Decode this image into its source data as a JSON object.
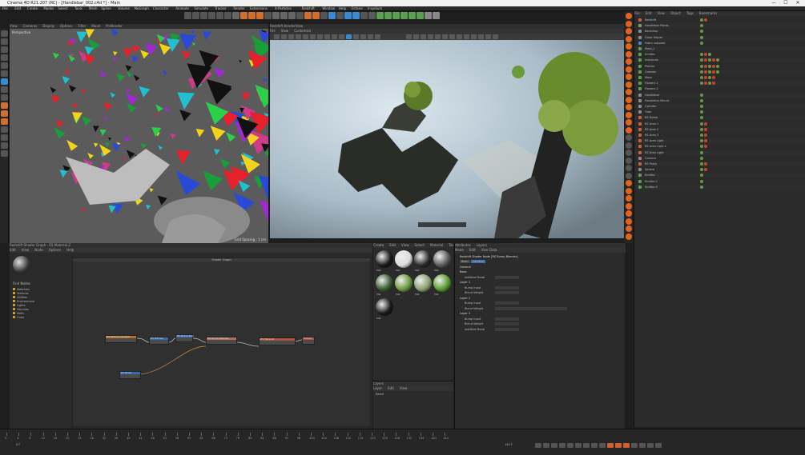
{
  "window": {
    "title": "Cinema 4D R21.207 (RC) - [Handlebar_002.c4d *] - Main",
    "minimize": "—",
    "maximize": "☐",
    "close": "✕"
  },
  "menu": [
    "File",
    "Edit",
    "Create",
    "Modes",
    "Select",
    "Tools",
    "Mesh",
    "Spline",
    "Volume",
    "MoGraph",
    "Character",
    "Animate",
    "Simulate",
    "Tracker",
    "Render",
    "Extensions",
    "X-Particles",
    "Redshift",
    "Window",
    "Help",
    "Octane",
    "Insydium"
  ],
  "viewport_left": {
    "menu": [
      "View",
      "Cameras",
      "Display",
      "Options",
      "Filter",
      "Panel",
      "ProRender"
    ],
    "corner_label": "Perspective",
    "grid_label": "Grid Spacing : 1 cm"
  },
  "viewport_right": {
    "header": "Redshift RenderView",
    "menu": [
      "File",
      "View",
      "Customize"
    ]
  },
  "object_manager": {
    "menu": [
      "File",
      "Edit",
      "View",
      "Object",
      "Tags",
      "Bookmarks"
    ],
    "objects": [
      {
        "name": "Redshift",
        "color": "#d06030",
        "tags": 2
      },
      {
        "name": "Handlebar Plants",
        "color": "#7aa060",
        "tags": 1
      },
      {
        "name": "Backdrop",
        "color": "#8a8a8a",
        "tags": 1
      },
      {
        "name": "Close Helper",
        "color": "#8a8a8a",
        "tags": 1
      },
      {
        "name": "Fabric adjuster",
        "color": "#4a88d0",
        "tags": 1
      },
      {
        "name": "Moss_L",
        "color": "#5aa050",
        "tags": 0
      },
      {
        "name": "Emitter",
        "color": "#5aa050",
        "tags": 3
      },
      {
        "name": "Instances",
        "color": "#5aa050",
        "tags": 5
      },
      {
        "name": "Planter",
        "color": "#5aa050",
        "tags": 5
      },
      {
        "name": "Grasses",
        "color": "#5aa050",
        "tags": 5
      },
      {
        "name": "Moss",
        "color": "#5aa050",
        "tags": 4
      },
      {
        "name": "Flowers 1",
        "color": "#5aa050",
        "tags": 4
      },
      {
        "name": "Flowers 2",
        "color": "#5aa050",
        "tags": 0
      },
      {
        "name": "Handlebar",
        "color": "#8a8a8a",
        "tags": 1
      },
      {
        "name": "Handlebar Mount",
        "color": "#8a8a8a",
        "tags": 1
      },
      {
        "name": "Cylinder",
        "color": "#8a8a8a",
        "tags": 1
      },
      {
        "name": "Tube",
        "color": "#8a8a8a",
        "tags": 1
      },
      {
        "name": "RS Dome",
        "color": "#d06030",
        "tags": 1
      },
      {
        "name": "RS Area 1",
        "color": "#d06030",
        "tags": 2
      },
      {
        "name": "RS Area 2",
        "color": "#d06030",
        "tags": 2
      },
      {
        "name": "RS Area 3",
        "color": "#d06030",
        "tags": 2
      },
      {
        "name": "RS Area Light",
        "color": "#d06030",
        "tags": 2
      },
      {
        "name": "RS Area Light.1",
        "color": "#d06030",
        "tags": 2
      },
      {
        "name": "RS Area Light",
        "color": "#d06030",
        "tags": 1
      },
      {
        "name": "Camera",
        "color": "#8a8a8a",
        "tags": 1
      },
      {
        "name": "RS Proxy",
        "color": "#d06030",
        "tags": 2
      },
      {
        "name": "Sphere",
        "color": "#8a8a8a",
        "tags": 2
      },
      {
        "name": "Emitter",
        "color": "#5aa050",
        "tags": 1
      },
      {
        "name": "Emitter.1",
        "color": "#5aa050",
        "tags": 1
      },
      {
        "name": "Emitter.2",
        "color": "#5aa050",
        "tags": 1
      }
    ]
  },
  "shader_graph": {
    "header": "Redshift Shader Graph - RS Material.2",
    "menu": [
      "Edit",
      "View",
      "Node",
      "Options",
      "Help"
    ],
    "canvas_title": "Shader Graph",
    "nodes_tab": "Find Nodes",
    "categories": [
      "Materials",
      "Textures",
      "Utilities",
      "Environment",
      "Lights",
      "Volumes",
      "Math",
      "Color"
    ],
    "nodes": [
      {
        "title": "RS Texture Sampler",
        "color": "#b07030"
      },
      {
        "title": "RS Bitmap",
        "color": "#3a6ab0"
      },
      {
        "title": "RS Bump Map",
        "color": "#3a6ab0"
      },
      {
        "title": "RS Bump Blender",
        "color": "#b07060"
      },
      {
        "title": "RS Material",
        "color": "#b05040"
      },
      {
        "title": "Output",
        "color": "#b05040"
      },
      {
        "title": "RS Noise",
        "color": "#3a6ab0"
      }
    ]
  },
  "material_manager": {
    "menu": [
      "Create",
      "Edit",
      "View",
      "Select",
      "Material",
      "Texture"
    ],
    "materials": [
      {
        "name": "Mat",
        "fill": "#1a1a1a"
      },
      {
        "name": "Mat",
        "fill": "#dcdcdc"
      },
      {
        "name": "Mat",
        "fill": "#2a2a2a"
      },
      {
        "name": "Mat",
        "fill": "#5a5a5a"
      },
      {
        "name": "Mat",
        "fill": "#3a5a30"
      },
      {
        "name": "Mat",
        "fill": "#6a9a40"
      },
      {
        "name": "Mat",
        "fill": "#8aa070"
      },
      {
        "name": "Mat",
        "fill": "#5a9a30"
      },
      {
        "name": "Mat",
        "fill": "#1a1a1a"
      }
    ]
  },
  "layers": {
    "title": "Layers",
    "menu": [
      "Layer",
      "Edit",
      "View"
    ],
    "col": "Name"
  },
  "attributes": {
    "tabs": [
      "Attributes",
      "Layers"
    ],
    "menu": [
      "Mode",
      "Edit",
      "User Data"
    ],
    "object": "Redshift Shader Node [RS Bump Blender]",
    "subtabs": [
      "Basic",
      "General"
    ],
    "section": "General",
    "rows": [
      "Base",
      "Additive Mode",
      "Layer 1",
      "Bump Input",
      "Blend Weight",
      "Layer 2",
      "Bump Input",
      "Blend Weight",
      "Layer 3",
      "Bump Input",
      "Blend Weight",
      "Additive Mode"
    ]
  },
  "timeline": {
    "frames": [
      "0",
      "4",
      "8",
      "12",
      "16",
      "20",
      "24",
      "28",
      "32",
      "36",
      "40",
      "44",
      "48",
      "52",
      "56",
      "60",
      "64",
      "68",
      "72",
      "76",
      "80",
      "84",
      "88",
      "92",
      "96",
      "100",
      "104",
      "108",
      "112",
      "116",
      "120",
      "124",
      "128",
      "132",
      "136",
      "140",
      "144"
    ],
    "current": "0 F",
    "end": "144 F"
  },
  "coords": {
    "headers": [
      "Position",
      "Size",
      "Rotation"
    ],
    "rows": [
      [
        "X",
        "0 cm",
        "0 cm",
        "H",
        "0°"
      ],
      [
        "Y",
        "0 cm",
        "0 cm",
        "P",
        "0°"
      ],
      [
        "Z",
        "0 cm",
        "0 cm",
        "B",
        "0°"
      ]
    ],
    "apply": "Apply"
  }
}
